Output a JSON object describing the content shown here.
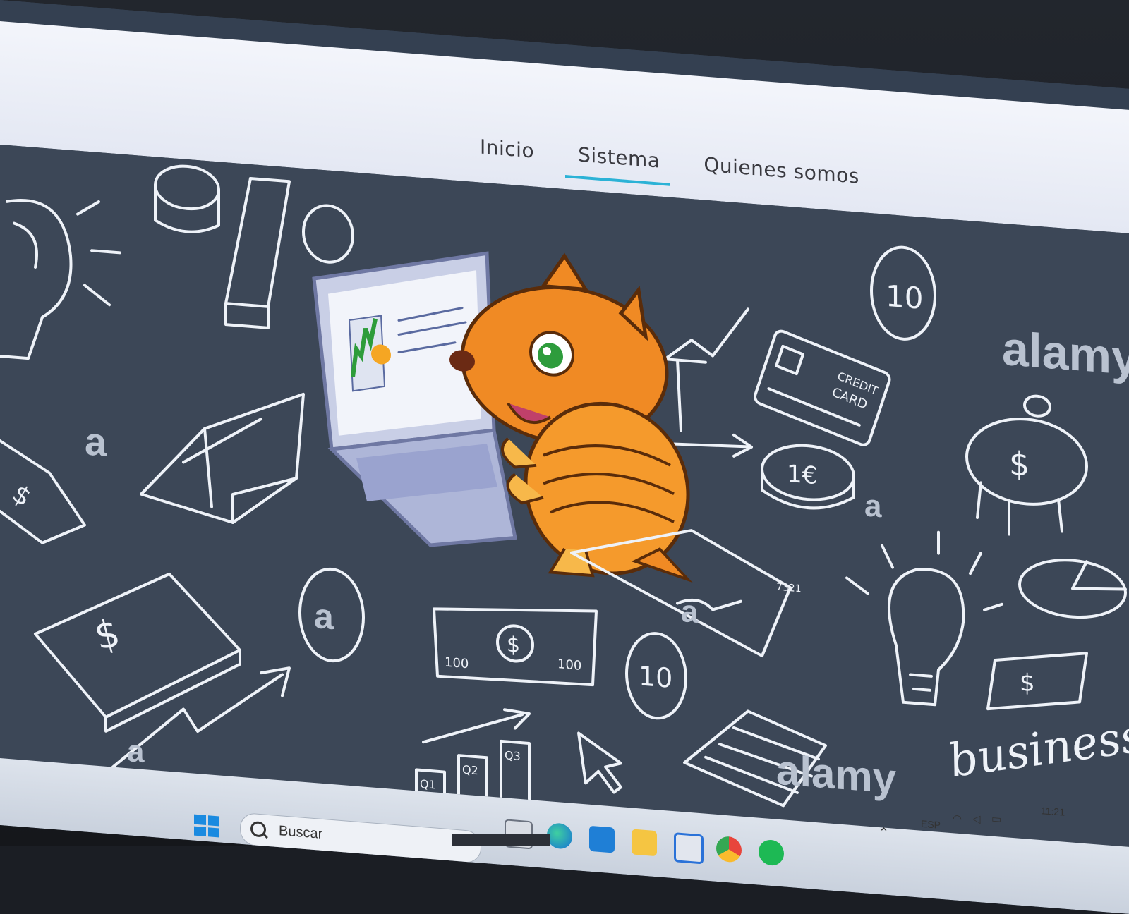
{
  "nav": {
    "links": [
      {
        "label": "Inicio"
      },
      {
        "label": "Sistema",
        "active": true
      },
      {
        "label": "Quienes somos"
      }
    ],
    "active_color": "#2bb2d6"
  },
  "hero": {
    "illustration": "armadillo-mascot-with-laptop-on-finance-doodle-background",
    "doodle_texts": {
      "credit_card": [
        "CREDIT",
        "CARD"
      ],
      "coin_values": [
        "10",
        "1€",
        "10"
      ],
      "banknote_values": [
        "100",
        "100"
      ],
      "chart_labels": [
        "Q1",
        "Q2",
        "Q3"
      ],
      "check_number": "7321",
      "script_word": "business"
    },
    "watermark": "alamy",
    "watermark_letter": "a",
    "background_color": "#3c4757",
    "mascot_color": "#f08a24"
  },
  "taskbar": {
    "search_placeholder": "Buscar",
    "language": "ESP",
    "time": "11:21",
    "icons": [
      "windows-start-icon",
      "search-icon",
      "task-view-icon",
      "edge-icon",
      "vscode-icon",
      "file-explorer-icon",
      "store-icon",
      "chrome-icon",
      "spotify-icon"
    ],
    "tray_icons": [
      "chevron-up-icon",
      "wifi-icon",
      "volume-icon",
      "battery-icon"
    ]
  }
}
